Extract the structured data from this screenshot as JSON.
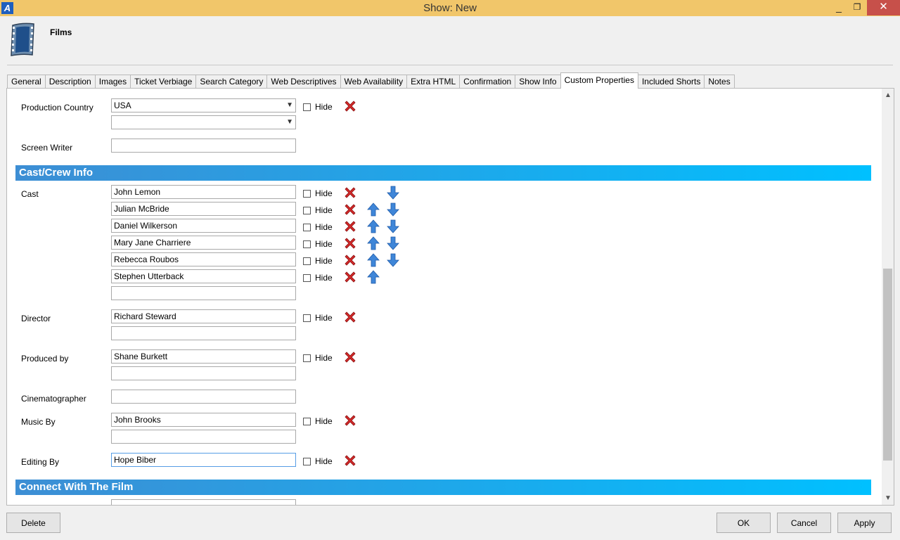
{
  "window": {
    "title": "Show: New",
    "app_icon_letter": "A",
    "minimize": "_",
    "maximize": "❐",
    "close": "✕"
  },
  "header": {
    "title": "Films"
  },
  "tabs": [
    "General",
    "Description",
    "Images",
    "Ticket Verbiage",
    "Search Category",
    "Web Descriptives",
    "Web Availability",
    "Extra HTML",
    "Confirmation",
    "Show Info",
    "Custom Properties",
    "Included Shorts",
    "Notes"
  ],
  "active_tab": "Custom Properties",
  "hide_label": "Hide",
  "fields": {
    "production_country": {
      "label": "Production Country",
      "values": [
        "USA",
        ""
      ]
    },
    "screen_writer": {
      "label": "Screen Writer",
      "value": ""
    },
    "cast": {
      "label": "Cast",
      "values": [
        "John Lemon",
        "Julian McBride",
        "Daniel Wilkerson",
        "Mary Jane Charriere",
        "Rebecca Roubos",
        "Stephen Utterback",
        ""
      ]
    },
    "director": {
      "label": "Director",
      "values": [
        "Richard Steward",
        ""
      ]
    },
    "produced_by": {
      "label": "Produced by",
      "values": [
        "Shane Burkett",
        ""
      ]
    },
    "cinematographer": {
      "label": "Cinematographer",
      "value": ""
    },
    "music_by": {
      "label": "Music By",
      "values": [
        "John Brooks",
        ""
      ]
    },
    "editing_by": {
      "label": "Editing By",
      "value": "Hope Biber"
    }
  },
  "sections": {
    "cast_crew": "Cast/Crew Info",
    "connect": "Connect With The Film"
  },
  "footer": {
    "delete": "Delete",
    "ok": "OK",
    "cancel": "Cancel",
    "apply": "Apply"
  },
  "colors": {
    "titlebar": "#f1c66a",
    "section_start": "#3d8ed4",
    "section_end": "#00c0ff",
    "close_button": "#c7504a"
  }
}
